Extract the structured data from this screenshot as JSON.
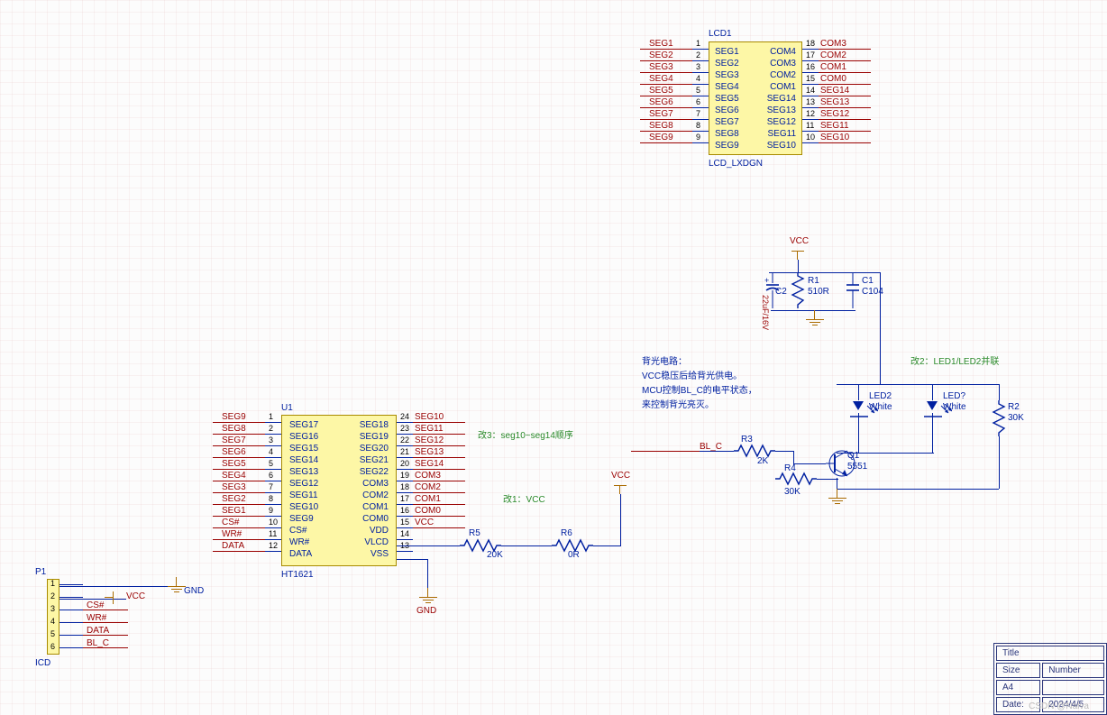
{
  "lcd1": {
    "ref": "LCD1",
    "model": "LCD_LXDGN",
    "left_pins": [
      {
        "num": "1",
        "name": "SEG1",
        "net": "SEG1"
      },
      {
        "num": "2",
        "name": "SEG2",
        "net": "SEG2"
      },
      {
        "num": "3",
        "name": "SEG3",
        "net": "SEG3"
      },
      {
        "num": "4",
        "name": "SEG4",
        "net": "SEG4"
      },
      {
        "num": "5",
        "name": "SEG5",
        "net": "SEG5"
      },
      {
        "num": "6",
        "name": "SEG6",
        "net": "SEG6"
      },
      {
        "num": "7",
        "name": "SEG7",
        "net": "SEG7"
      },
      {
        "num": "8",
        "name": "SEG8",
        "net": "SEG8"
      },
      {
        "num": "9",
        "name": "SEG9",
        "net": "SEG9"
      }
    ],
    "right_pins": [
      {
        "num": "18",
        "name": "COM4",
        "net": "COM3"
      },
      {
        "num": "17",
        "name": "COM3",
        "net": "COM2"
      },
      {
        "num": "16",
        "name": "COM2",
        "net": "COM1"
      },
      {
        "num": "15",
        "name": "COM1",
        "net": "COM0"
      },
      {
        "num": "14",
        "name": "SEG14",
        "net": "SEG14"
      },
      {
        "num": "13",
        "name": "SEG13",
        "net": "SEG13"
      },
      {
        "num": "12",
        "name": "SEG12",
        "net": "SEG12"
      },
      {
        "num": "11",
        "name": "SEG11",
        "net": "SEG11"
      },
      {
        "num": "10",
        "name": "SEG10",
        "net": "SEG10"
      }
    ]
  },
  "u1": {
    "ref": "U1",
    "model": "HT1621",
    "left_pins": [
      {
        "num": "1",
        "name": "SEG17",
        "net": "SEG9"
      },
      {
        "num": "2",
        "name": "SEG16",
        "net": "SEG8"
      },
      {
        "num": "3",
        "name": "SEG15",
        "net": "SEG7"
      },
      {
        "num": "4",
        "name": "SEG14",
        "net": "SEG6"
      },
      {
        "num": "5",
        "name": "SEG13",
        "net": "SEG5"
      },
      {
        "num": "6",
        "name": "SEG12",
        "net": "SEG4"
      },
      {
        "num": "7",
        "name": "SEG11",
        "net": "SEG3"
      },
      {
        "num": "8",
        "name": "SEG10",
        "net": "SEG2"
      },
      {
        "num": "9",
        "name": "SEG9",
        "net": "SEG1"
      },
      {
        "num": "10",
        "name": "CS#",
        "net": "CS#"
      },
      {
        "num": "11",
        "name": "WR#",
        "net": "WR#"
      },
      {
        "num": "12",
        "name": "DATA",
        "net": "DATA"
      }
    ],
    "right_pins": [
      {
        "num": "24",
        "name": "SEG18",
        "net": "SEG10"
      },
      {
        "num": "23",
        "name": "SEG19",
        "net": "SEG11"
      },
      {
        "num": "22",
        "name": "SEG20",
        "net": "SEG12"
      },
      {
        "num": "21",
        "name": "SEG21",
        "net": "SEG13"
      },
      {
        "num": "20",
        "name": "SEG22",
        "net": "SEG14"
      },
      {
        "num": "19",
        "name": "COM3",
        "net": "COM3"
      },
      {
        "num": "18",
        "name": "COM2",
        "net": "COM2"
      },
      {
        "num": "17",
        "name": "COM1",
        "net": "COM1"
      },
      {
        "num": "16",
        "name": "COM0",
        "net": "COM0"
      },
      {
        "num": "15",
        "name": "VDD",
        "net": "VCC"
      },
      {
        "num": "14",
        "name": "VLCD",
        "net": ""
      },
      {
        "num": "13",
        "name": "VSS",
        "net": ""
      }
    ]
  },
  "p1": {
    "ref": "P1",
    "model": "ICD",
    "pins": [
      "1",
      "2",
      "3",
      "4",
      "5",
      "6"
    ],
    "nets": [
      "GND",
      "VCC",
      "CS#",
      "WR#",
      "DATA",
      "BL_C"
    ]
  },
  "backlight": {
    "vcc": "VCC",
    "c2": {
      "ref": "C2",
      "val": "22uF/16V"
    },
    "r1": {
      "ref": "R1",
      "val": "510R"
    },
    "c1": {
      "ref": "C1",
      "val": "C104"
    },
    "led2": {
      "ref": "LED2",
      "val": "White"
    },
    "led1": {
      "ref": "LED?",
      "val": "White"
    },
    "r2": {
      "ref": "R2",
      "val": "30K"
    },
    "r3": {
      "ref": "R3",
      "val": "2K"
    },
    "r4": {
      "ref": "R4",
      "val": "30K"
    },
    "q1": {
      "ref": "Q1",
      "val": "5551"
    },
    "bl_c": "BL_C",
    "note1": "背光电路：",
    "note2": "VCC稳压后给背光供电。",
    "note3": "MCU控制BL_C的电平状态，",
    "note4": "来控制背光亮灭。",
    "mod2": "改2：LED1/LED2并联"
  },
  "r5": {
    "ref": "R5",
    "val": "20K"
  },
  "r6": {
    "ref": "R6",
    "val": "0R"
  },
  "mod1": "改1：VCC",
  "mod3": "改3：seg10~seg14顺序",
  "gnd_label": "GND",
  "vcc_label": "VCC",
  "title_block": {
    "title_hdr": "Title",
    "size_hdr": "Size",
    "size": "A4",
    "number_hdr": "Number",
    "date_hdr": "Date:",
    "date": "2024/4/5"
  },
  "watermark": "CSDN @Naiva"
}
